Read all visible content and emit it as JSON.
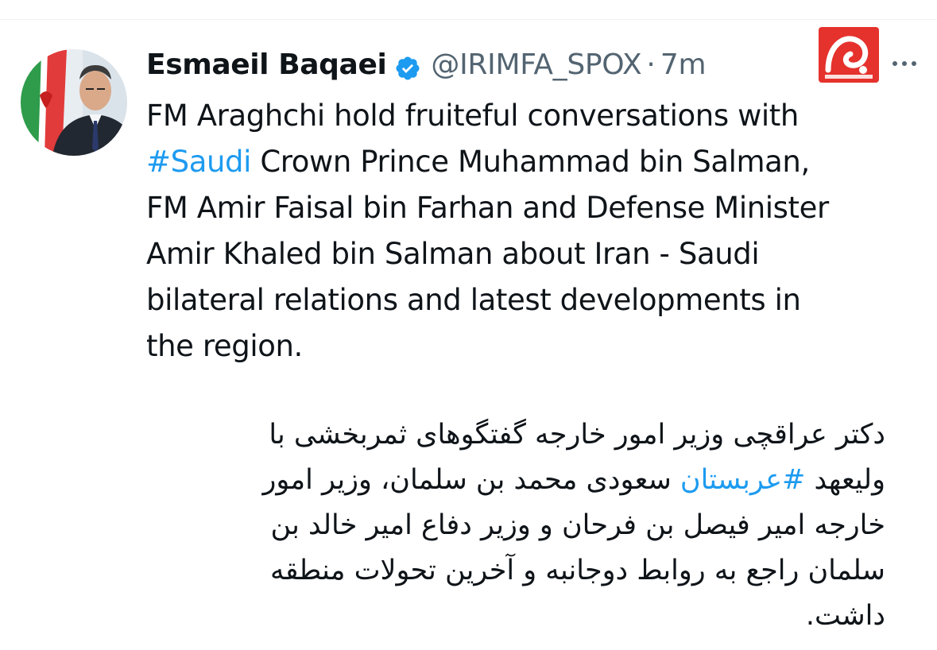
{
  "author": {
    "name": "Esmaeil Baqaei",
    "handle": "@IRIMFA_SPOX",
    "separator": "·",
    "time": "7m",
    "verified_icon": "verified-badge-icon"
  },
  "tweet": {
    "english_lines": [
      {
        "text": "FM Araghchi hold fruiteful conversations with"
      },
      {
        "hashtag": "#Saudi",
        "text": " Crown Prince Muhammad bin Salman,"
      },
      {
        "text": "FM Amir Faisal bin Farhan and Defense Minister"
      },
      {
        "text": "Amir Khaled bin Salman about Iran - Saudi"
      },
      {
        "text": "bilateral relations and latest developments in"
      },
      {
        "text": "the region."
      }
    ],
    "persian_lines": [
      {
        "text": "دکتر عراقچی وزیر امور خارجه گفتگوهای ثمربخشی با"
      },
      {
        "before": "ولیعهد ",
        "hashtag": "#عربستان",
        "after": " سعودی محمد بن سلمان، وزیر امور"
      },
      {
        "text": "خارجه امیر فیصل بن فرحان و وزیر دفاع امیر خالد بن"
      },
      {
        "text": "سلمان راجع به روابط دوجانبه و آخرین تحولات منطقه"
      },
      {
        "text": "داشت."
      }
    ]
  },
  "colors": {
    "link": "#1d9bf0",
    "secondary_text": "#536471",
    "primary_text": "#0f1419",
    "logo_red": "#e5322d"
  },
  "icons": {
    "more": "more-options-icon",
    "logo": "news-agency-logo"
  }
}
